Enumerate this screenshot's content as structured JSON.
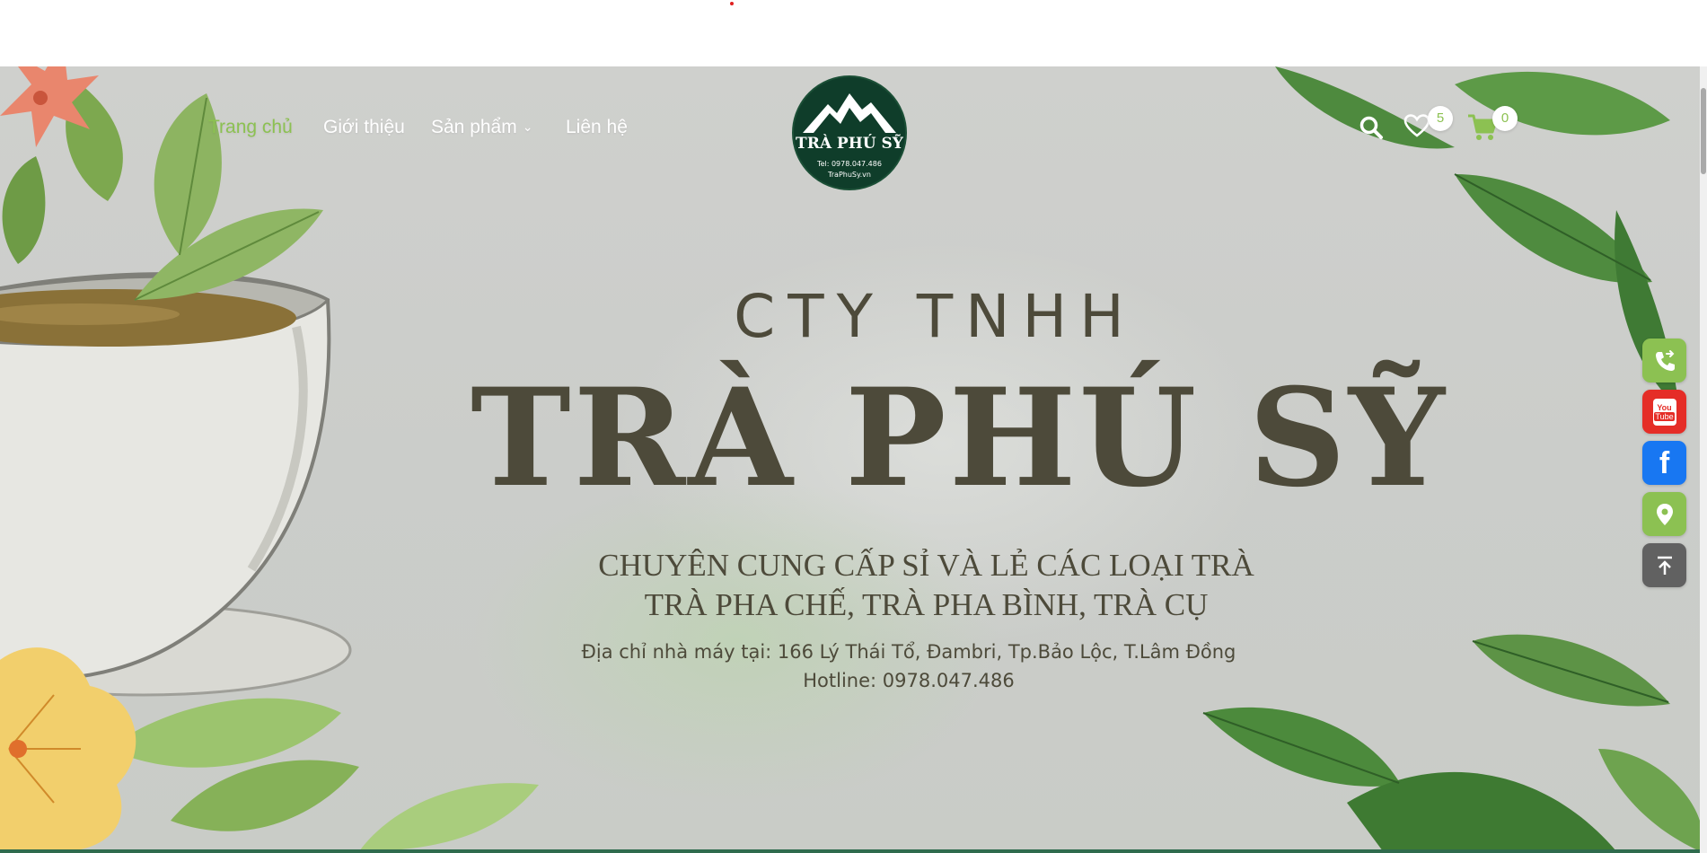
{
  "nav": {
    "items": [
      {
        "label": "Trang chủ",
        "active": true
      },
      {
        "label": "Giới thiệu",
        "active": false
      },
      {
        "label": "Sản phẩm",
        "active": false,
        "has_dropdown": true
      },
      {
        "label": "Liên hệ",
        "active": false
      }
    ],
    "dropdown_icon": "chevron-down-icon"
  },
  "logo": {
    "name": "TRÀ PHÚ SỸ",
    "tel": "Tel: 0978.047.486",
    "website": "TraPhuSy.vn"
  },
  "header_actions": {
    "search_icon": "search-icon",
    "wishlist_icon": "heart-icon",
    "wishlist_count": "5",
    "cart_icon": "cart-icon",
    "cart_count": "0"
  },
  "hero": {
    "company_type": "CTY TNHH",
    "company_name": "TRÀ PHÚ SỸ",
    "tagline_1": "CHUYÊN CUNG CẤP SỈ VÀ LẺ CÁC LOẠI TRÀ",
    "tagline_2": "TRÀ PHA CHẾ, TRÀ PHA BÌNH, TRÀ CỤ",
    "address": "Địa chỉ nhà máy tại: 166 Lý Thái Tổ, Đambri, Tp.Bảo Lộc, T.Lâm Đồng",
    "hotline": "Hotline: 0978.047.486"
  },
  "side_buttons": [
    {
      "name": "phone-icon",
      "color": "#8cc152"
    },
    {
      "name": "youtube-icon",
      "color": "#e52d27",
      "text_top": "You",
      "text_bottom": "Tube"
    },
    {
      "name": "facebook-icon",
      "color": "#1877f2",
      "text": "f"
    },
    {
      "name": "map-pin-icon",
      "color": "#8cc152"
    },
    {
      "name": "back-to-top-icon",
      "color": "#616161"
    }
  ],
  "colors": {
    "accent_green": "#8cc152",
    "headline_brown": "#4d4a3a",
    "logo_bg": "#0f3d2a"
  }
}
